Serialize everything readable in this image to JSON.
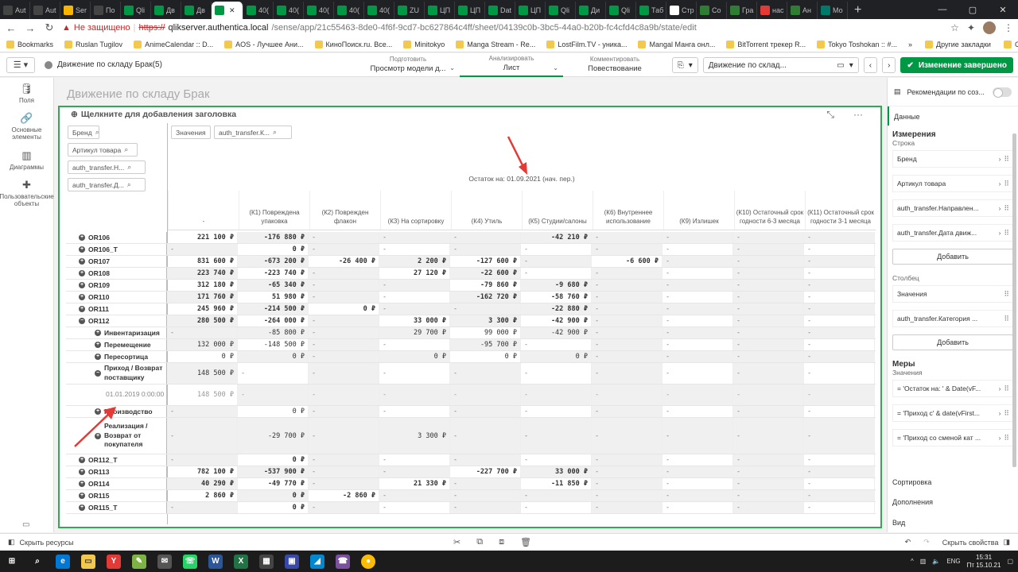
{
  "browser": {
    "tabs": [
      {
        "label": "Aut",
        "color": "#444"
      },
      {
        "label": "Aut",
        "color": "#444"
      },
      {
        "label": "Ser",
        "color": "#f7b500"
      },
      {
        "label": "По",
        "color": "#444"
      },
      {
        "label": "Qli",
        "color": "#009845"
      },
      {
        "label": "Дв",
        "color": "#009845"
      },
      {
        "label": "Дв",
        "color": "#009845"
      },
      {
        "label": "",
        "color": "#009845",
        "active": true
      },
      {
        "label": "40(",
        "color": "#009845"
      },
      {
        "label": "40(",
        "color": "#009845"
      },
      {
        "label": "40(",
        "color": "#009845"
      },
      {
        "label": "40(",
        "color": "#009845"
      },
      {
        "label": "40(",
        "color": "#009845"
      },
      {
        "label": "ZU",
        "color": "#009845"
      },
      {
        "label": "ЦП",
        "color": "#009845"
      },
      {
        "label": "ЦП",
        "color": "#009845"
      },
      {
        "label": "Dat",
        "color": "#009845"
      },
      {
        "label": "ЦП",
        "color": "#009845"
      },
      {
        "label": "Qli",
        "color": "#009845"
      },
      {
        "label": "Ди",
        "color": "#009845"
      },
      {
        "label": "Qli",
        "color": "#009845"
      },
      {
        "label": "Таб",
        "color": "#009845"
      },
      {
        "label": "Стр",
        "color": "#fff"
      },
      {
        "label": "Со",
        "color": "#2e7d32"
      },
      {
        "label": "Гра",
        "color": "#2e7d32"
      },
      {
        "label": "нас",
        "color": "#e53935"
      },
      {
        "label": "Ан",
        "color": "#2e7d32"
      },
      {
        "label": "Мо",
        "color": "#00796b"
      }
    ],
    "not_secure": "Не защищено",
    "url_scheme": "https://",
    "url_host": "qlikserver.authentica.local",
    "url_path": "/sense/app/21c55463-8de0-4f6f-9cd7-bc627864c4ff/sheet/04139c0b-3bc5-44a0-b20b-fc4cfd4c8a9b/state/edit",
    "bookmarks": [
      "Bookmarks",
      "Ruslan Tugilov",
      "AnimeCalendar :: D...",
      "AOS - Лучшее Ани...",
      "КиноПоиск.ru. Все...",
      "Minitokyo",
      "Manga Stream - Re...",
      "LostFilm.TV - уника...",
      "Mangal Манга онл...",
      "BitTorrent трекер R...",
      "Tokyo Toshokan :: #..."
    ],
    "bookmarks_right": [
      "Другие закладки",
      "Список для чтения"
    ]
  },
  "toolbar": {
    "app_name": "Движение по складу Брак(5)",
    "modes": [
      {
        "small": "Подготовить",
        "value": "Просмотр модели д...",
        "active": false
      },
      {
        "small": "Анализировать",
        "value": "Лист",
        "active": true
      },
      {
        "small": "Комментировать",
        "value": "Повествование",
        "active": false
      }
    ],
    "sheet_selector": "Движение по склад...",
    "done_label": "Изменение завершено"
  },
  "left_panel": [
    {
      "icon": "database-icon",
      "glyph": "🛢",
      "label": "Поля"
    },
    {
      "icon": "link-icon",
      "glyph": "🔗",
      "label": "Основные элементы"
    },
    {
      "icon": "chart-icon",
      "glyph": "▥",
      "label": "Диаграммы"
    },
    {
      "icon": "puzzle-icon",
      "glyph": "✚",
      "label": "Пользовательские объекты"
    }
  ],
  "sheet": {
    "title": "Движение по складу Брак",
    "object_title": "Щелкните для добавления заголовка",
    "row_filters": [
      "Бренд",
      "Артикул товара",
      "auth_transfer.Н...",
      "auth_transfer.Д..."
    ],
    "col_filters": [
      "Значения",
      "auth_transfer.К..."
    ],
    "ostatok": "Остаток на: 01.09.2021 (нач. пер.)",
    "headers": [
      "-",
      "(К1) Повреждена упаковка",
      "(К2) Поврежден флакон",
      "(К3) На сортировку",
      "(К4) Утиль",
      "(К5) Студии/салоны",
      "(К6) Внутреннее использование",
      "(К9) Излишек",
      "(К10) Остаточный срок годности 6-3 месяца",
      "(К11) Остаточный срок годности 3-1 месяца"
    ],
    "rows": [
      {
        "label": "OR106",
        "pm": "+",
        "level": 1,
        "cells": [
          "221 100 ₽",
          "-176 880 ₽",
          "-",
          "-",
          "-",
          "-42 210 ₽",
          "-",
          "-",
          "-",
          "-"
        ]
      },
      {
        "label": "OR106_T",
        "pm": "+",
        "level": 1,
        "cells": [
          "-",
          "0 ₽",
          "-",
          "-",
          "-",
          "-",
          "-",
          "-",
          "-",
          "-"
        ]
      },
      {
        "label": "OR107",
        "pm": "+",
        "level": 1,
        "cells": [
          "831 600 ₽",
          "-673 200 ₽",
          "-26 400 ₽",
          "2 200 ₽",
          "-127 600 ₽",
          "-",
          "-6 600 ₽",
          "-",
          "-",
          "-"
        ]
      },
      {
        "label": "OR108",
        "pm": "+",
        "level": 1,
        "cells": [
          "223 740 ₽",
          "-223 740 ₽",
          "-",
          "27 120 ₽",
          "-22 600 ₽",
          "-",
          "-",
          "-",
          "-",
          "-"
        ]
      },
      {
        "label": "OR109",
        "pm": "+",
        "level": 1,
        "cells": [
          "312 180 ₽",
          "-65 340 ₽",
          "-",
          "-",
          "-79 860 ₽",
          "-9 680 ₽",
          "-",
          "-",
          "-",
          "-"
        ]
      },
      {
        "label": "OR110",
        "pm": "+",
        "level": 1,
        "cells": [
          "171 760 ₽",
          "51 980 ₽",
          "-",
          "-",
          "-162 720 ₽",
          "-58 760 ₽",
          "-",
          "-",
          "-",
          "-"
        ]
      },
      {
        "label": "OR111",
        "pm": "+",
        "level": 1,
        "cells": [
          "245 960 ₽",
          "-214 500 ₽",
          "0 ₽",
          "-",
          "-",
          "-22 880 ₽",
          "-",
          "-",
          "-",
          "-"
        ]
      },
      {
        "label": "OR112",
        "pm": "−",
        "level": 1,
        "cells": [
          "280 500 ₽",
          "-264 000 ₽",
          "-",
          "33 000 ₽",
          "3 300 ₽",
          "-42 900 ₽",
          "-",
          "-",
          "-",
          "-"
        ]
      },
      {
        "label": "Инвентаризация",
        "pm": "+",
        "level": 2,
        "cells": [
          "-",
          "-85 800 ₽",
          "-",
          "29 700 ₽",
          "99 000 ₽",
          "-42 900 ₽",
          "-",
          "-",
          "-",
          "-"
        ]
      },
      {
        "label": "Перемещение",
        "pm": "+",
        "level": 2,
        "cells": [
          "132 000 ₽",
          "-148 500 ₽",
          "-",
          "-",
          "-95 700 ₽",
          "-",
          "-",
          "-",
          "-",
          "-"
        ]
      },
      {
        "label": "Пересортица",
        "pm": "+",
        "level": 2,
        "cells": [
          "0 ₽",
          "0 ₽",
          "-",
          "0 ₽",
          "0 ₽",
          "0 ₽",
          "-",
          "-",
          "-",
          "-"
        ]
      },
      {
        "label": "Приход / Возврат поставщику",
        "pm": "−",
        "level": 2,
        "tall": true,
        "cells": [
          "148 500 ₽",
          "-",
          "-",
          "-",
          "-",
          "-",
          "-",
          "-",
          "-",
          "-"
        ]
      },
      {
        "label": "01.01.2019 0:00:00",
        "pm": "",
        "level": 3,
        "tall": true,
        "cells": [
          "148 500 ₽",
          "-",
          "-",
          "-",
          "-",
          "-",
          "-",
          "-",
          "-",
          "-"
        ]
      },
      {
        "label": "Производство",
        "pm": "+",
        "level": 2,
        "cells": [
          "-",
          "0 ₽",
          "-",
          "-",
          "-",
          "-",
          "-",
          "-",
          "-",
          "-"
        ]
      },
      {
        "label": "Реализация / Возврат от покупателя",
        "pm": "+",
        "level": 2,
        "tall2": true,
        "cells": [
          "-",
          "-29 700 ₽",
          "-",
          "3 300 ₽",
          "-",
          "-",
          "-",
          "-",
          "-",
          "-"
        ]
      },
      {
        "label": "OR112_T",
        "pm": "+",
        "level": 1,
        "cells": [
          "-",
          "0 ₽",
          "-",
          "-",
          "-",
          "-",
          "-",
          "-",
          "-",
          "-"
        ]
      },
      {
        "label": "OR113",
        "pm": "+",
        "level": 1,
        "cells": [
          "782 100 ₽",
          "-537 900 ₽",
          "-",
          "-",
          "-227 700 ₽",
          "33 000 ₽",
          "-",
          "-",
          "-",
          "-"
        ]
      },
      {
        "label": "OR114",
        "pm": "+",
        "level": 1,
        "cells": [
          "40 290 ₽",
          "-49 770 ₽",
          "-",
          "21 330 ₽",
          "-",
          "-11 850 ₽",
          "-",
          "-",
          "-",
          "-"
        ]
      },
      {
        "label": "OR115",
        "pm": "+",
        "level": 1,
        "cells": [
          "2 860 ₽",
          "0 ₽",
          "-2 860 ₽",
          "-",
          "-",
          "-",
          "-",
          "-",
          "-",
          "-"
        ]
      },
      {
        "label": "OR115_T",
        "pm": "+",
        "level": 1,
        "cells": [
          "-",
          "0 ₽",
          "-",
          "-",
          "-",
          "-",
          "-",
          "-",
          "-",
          "-"
        ]
      }
    ]
  },
  "right_panel": {
    "recommend": "Рекомендации по соз...",
    "data_tab": "Данные",
    "dimensions_title": "Измерения",
    "rows_label": "Строка",
    "row_fields": [
      "Бренд",
      "Артикул товара",
      "auth_transfer.Направлен...",
      "auth_transfer.Дата движ..."
    ],
    "add_label": "Добавить",
    "cols_label": "Столбец",
    "col_fields": [
      "Значения",
      "auth_transfer.Категория ..."
    ],
    "measures_title": "Меры",
    "values_label": "Значения",
    "measure_fields": [
      "= 'Остаток на: ' & Date(vF...",
      "= 'Приход с' & date(vFirst...",
      "= 'Приход со сменой кат ..."
    ],
    "links": [
      "Сортировка",
      "Дополнения",
      "Вид"
    ]
  },
  "bottom": {
    "hide_assets": "Скрыть ресурсы",
    "hide_props": "Скрыть свойства"
  },
  "taskbar": {
    "lang": "ENG",
    "time": "15:31",
    "date": "Пт 15.10.21"
  }
}
